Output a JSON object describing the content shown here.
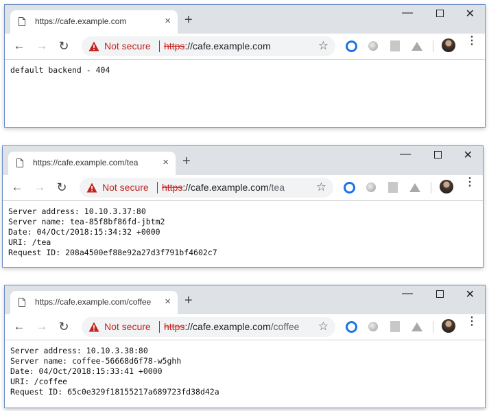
{
  "windows": [
    {
      "tab_title": "https://cafe.example.com",
      "security_label": "Not secure",
      "url_scheme": "https",
      "url_host": "://cafe.example.com",
      "url_path": "",
      "content_lines": [
        "default backend - 404"
      ]
    },
    {
      "tab_title": "https://cafe.example.com/tea",
      "security_label": "Not secure",
      "url_scheme": "https",
      "url_host": "://cafe.example.com",
      "url_path": "/tea",
      "content_lines": [
        "Server address: 10.10.3.37:80",
        "Server name: tea-85f8bf86fd-jbtm2",
        "Date: 04/Oct/2018:15:34:32 +0000",
        "URI: /tea",
        "Request ID: 208a4500ef88e92a27d3f791bf4602c7"
      ]
    },
    {
      "tab_title": "https://cafe.example.com/coffee",
      "security_label": "Not secure",
      "url_scheme": "https",
      "url_host": "://cafe.example.com",
      "url_path": "/coffee",
      "content_lines": [
        "Server address: 10.10.3.38:80",
        "Server name: coffee-56668d6f78-w5ghh",
        "Date: 04/Oct/2018:15:33:41 +0000",
        "URI: /coffee",
        "Request ID: 65c0e329f18155217a689723fd38d42a"
      ]
    }
  ],
  "icons": {
    "tab_close": "×",
    "new_tab": "+",
    "minimize": "—",
    "close": "✕",
    "back": "←",
    "forward": "→",
    "reload": "↻",
    "bookmark": "☆",
    "menu": "⋮"
  },
  "colors": {
    "not_secure": "#c5221f",
    "titlebar": "#dee1e6",
    "window_border": "#6a8fc7"
  }
}
